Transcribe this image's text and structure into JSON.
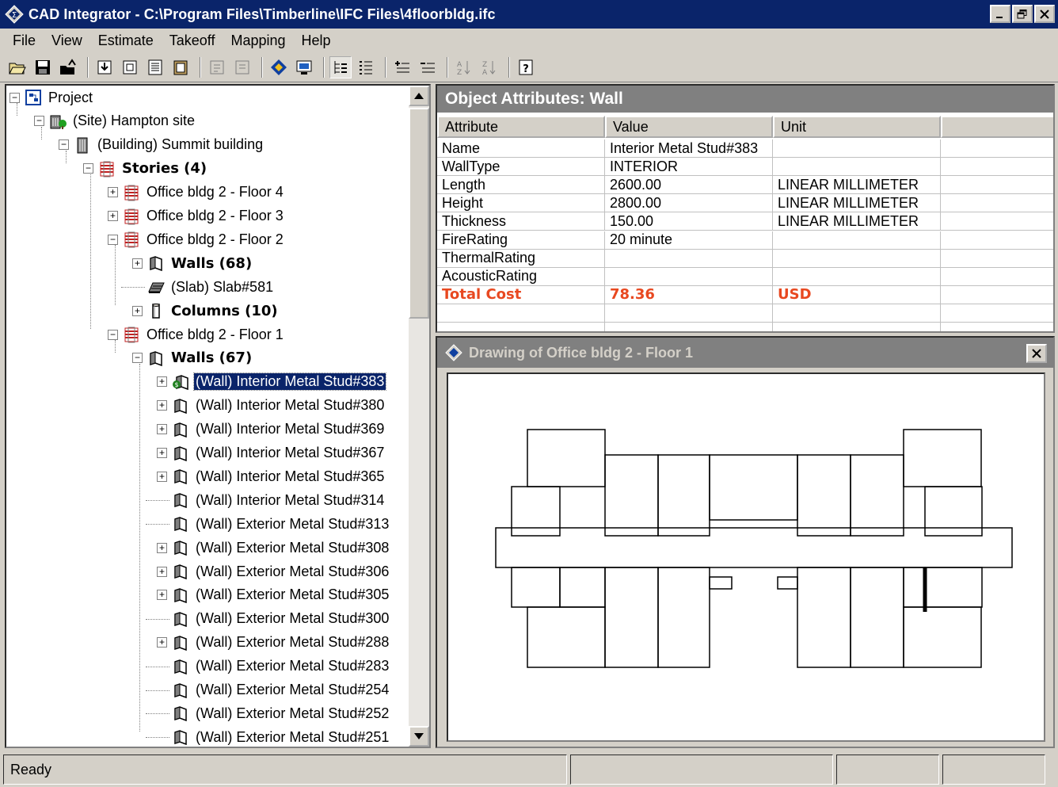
{
  "window": {
    "title": "CAD Integrator - C:\\Program Files\\Timberline\\IFC Files\\4floorbldg.ifc"
  },
  "menu": [
    "File",
    "View",
    "Estimate",
    "Takeoff",
    "Mapping",
    "Help"
  ],
  "tree": [
    {
      "label": "Project",
      "icon": "project-icon",
      "bold": false,
      "expander": "minus"
    },
    {
      "label": "(Site)  Hampton site",
      "icon": "site-icon",
      "bold": false,
      "expander": "minus"
    },
    {
      "label": "(Building)  Summit building",
      "icon": "building-icon",
      "bold": false,
      "expander": "minus"
    },
    {
      "label": "Stories  (4)",
      "icon": "stories-icon",
      "bold": true,
      "expander": "minus"
    },
    {
      "label": "Office bldg 2 - Floor 4",
      "icon": "floor-icon",
      "bold": false,
      "expander": "plus"
    },
    {
      "label": "Office bldg 2 - Floor 3",
      "icon": "floor-icon",
      "bold": false,
      "expander": "plus"
    },
    {
      "label": "Office bldg 2 - Floor 2",
      "icon": "floor-icon",
      "bold": false,
      "expander": "minus"
    },
    {
      "label": "Walls  (68)",
      "icon": "wall-icon",
      "bold": true,
      "expander": "plus"
    },
    {
      "label": "(Slab)  Slab#581",
      "icon": "slab-icon",
      "bold": false,
      "expander": "none"
    },
    {
      "label": "Columns  (10)",
      "icon": "column-icon",
      "bold": true,
      "expander": "plus"
    },
    {
      "label": "Office bldg 2 - Floor 1",
      "icon": "floor-icon",
      "bold": false,
      "expander": "minus"
    },
    {
      "label": "Walls  (67)",
      "icon": "wall-icon",
      "bold": true,
      "expander": "minus"
    },
    {
      "label": "(Wall)  Interior Metal Stud#383",
      "icon": "wall-mapped-icon",
      "bold": false,
      "expander": "plus",
      "selected": true
    },
    {
      "label": "(Wall)  Interior Metal Stud#380",
      "icon": "wall-icon",
      "bold": false,
      "expander": "plus"
    },
    {
      "label": "(Wall)  Interior Metal Stud#369",
      "icon": "wall-icon",
      "bold": false,
      "expander": "plus"
    },
    {
      "label": "(Wall)  Interior Metal Stud#367",
      "icon": "wall-icon",
      "bold": false,
      "expander": "plus"
    },
    {
      "label": "(Wall)  Interior Metal Stud#365",
      "icon": "wall-icon",
      "bold": false,
      "expander": "plus"
    },
    {
      "label": "(Wall)  Interior Metal Stud#314",
      "icon": "wall-icon",
      "bold": false,
      "expander": "none"
    },
    {
      "label": "(Wall)  Exterior Metal Stud#313",
      "icon": "wall-icon",
      "bold": false,
      "expander": "none"
    },
    {
      "label": "(Wall)  Exterior Metal Stud#308",
      "icon": "wall-icon",
      "bold": false,
      "expander": "plus"
    },
    {
      "label": "(Wall)  Exterior Metal Stud#306",
      "icon": "wall-icon",
      "bold": false,
      "expander": "plus"
    },
    {
      "label": "(Wall)  Exterior Metal Stud#305",
      "icon": "wall-icon",
      "bold": false,
      "expander": "plus"
    },
    {
      "label": "(Wall)  Exterior Metal Stud#300",
      "icon": "wall-icon",
      "bold": false,
      "expander": "none"
    },
    {
      "label": "(Wall)  Exterior Metal Stud#288",
      "icon": "wall-icon",
      "bold": false,
      "expander": "plus"
    },
    {
      "label": "(Wall)  Exterior Metal Stud#283",
      "icon": "wall-icon",
      "bold": false,
      "expander": "none"
    },
    {
      "label": "(Wall)  Exterior Metal Stud#254",
      "icon": "wall-icon",
      "bold": false,
      "expander": "none"
    },
    {
      "label": "(Wall)  Exterior Metal Stud#252",
      "icon": "wall-icon",
      "bold": false,
      "expander": "none"
    },
    {
      "label": "(Wall)  Exterior Metal Stud#251",
      "icon": "wall-icon",
      "bold": false,
      "expander": "none"
    }
  ],
  "attributes": {
    "title": "Object Attributes: Wall",
    "columns": [
      "Attribute",
      "Value",
      "Unit"
    ],
    "rows": [
      {
        "attribute": "Name",
        "value": "Interior Metal Stud#383",
        "unit": ""
      },
      {
        "attribute": "WallType",
        "value": "INTERIOR",
        "unit": ""
      },
      {
        "attribute": "Length",
        "value": "2600.00",
        "unit": "LINEAR MILLIMETER"
      },
      {
        "attribute": "Height",
        "value": "2800.00",
        "unit": "LINEAR MILLIMETER"
      },
      {
        "attribute": "Thickness",
        "value": "150.00",
        "unit": "LINEAR MILLIMETER"
      },
      {
        "attribute": "FireRating",
        "value": "20 minute",
        "unit": ""
      },
      {
        "attribute": "ThermalRating",
        "value": "",
        "unit": ""
      },
      {
        "attribute": "AcousticRating",
        "value": "",
        "unit": ""
      },
      {
        "attribute": "Total Cost",
        "value": "78.36",
        "unit": "USD",
        "highlight": true
      }
    ],
    "highlight_color": "#e84820"
  },
  "drawing": {
    "title": "Drawing of Office bldg 2 - Floor 1"
  },
  "status": {
    "text": "Ready"
  },
  "colors": {
    "titlebar": "#0a246a",
    "selection": "#0a246a",
    "panel_header": "#808080"
  }
}
